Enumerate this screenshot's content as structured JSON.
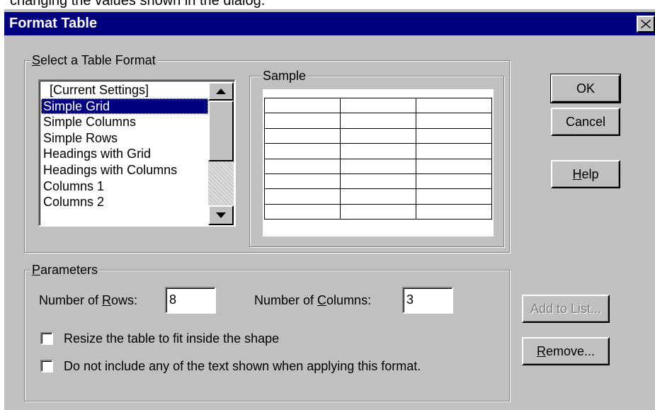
{
  "page_caption": "changing the values shown in the dialog.",
  "dialog": {
    "title": "Format Table",
    "close_icon": "close-icon"
  },
  "select_group": {
    "label_prefix": "",
    "label_accel": "S",
    "label_rest": "elect a Table Format",
    "items": [
      "[Current Settings]",
      "Simple Grid",
      "Simple Columns",
      "Simple Rows",
      "Headings with Grid",
      "Headings with Columns",
      "Columns 1",
      "Columns 2"
    ],
    "selected_index": 1,
    "scroll_up_icon": "scroll-up-arrow-icon",
    "scroll_down_icon": "scroll-down-arrow-icon"
  },
  "sample_group": {
    "label": "Sample",
    "rows": 8,
    "columns": 3
  },
  "buttons": {
    "ok": "OK",
    "cancel": "Cancel",
    "help_accel": "H",
    "help_rest": "elp",
    "add_to_list": "Add to List...",
    "remove_accel": "R",
    "remove_rest": "emove..."
  },
  "parameters": {
    "label_accel": "P",
    "label_rest": "arameters",
    "rows_label_prefix": "Number of ",
    "rows_label_accel": "R",
    "rows_label_rest": "ows:",
    "rows_value": "8",
    "columns_label_prefix": "Number of ",
    "columns_label_accel": "C",
    "columns_label_rest": "olumns:",
    "columns_value": "3",
    "resize_label": "Resize the table to fit inside the shape",
    "resize_checked": false,
    "exclude_text_label": "Do not include any of the text shown when applying this format.",
    "exclude_text_checked": false
  }
}
